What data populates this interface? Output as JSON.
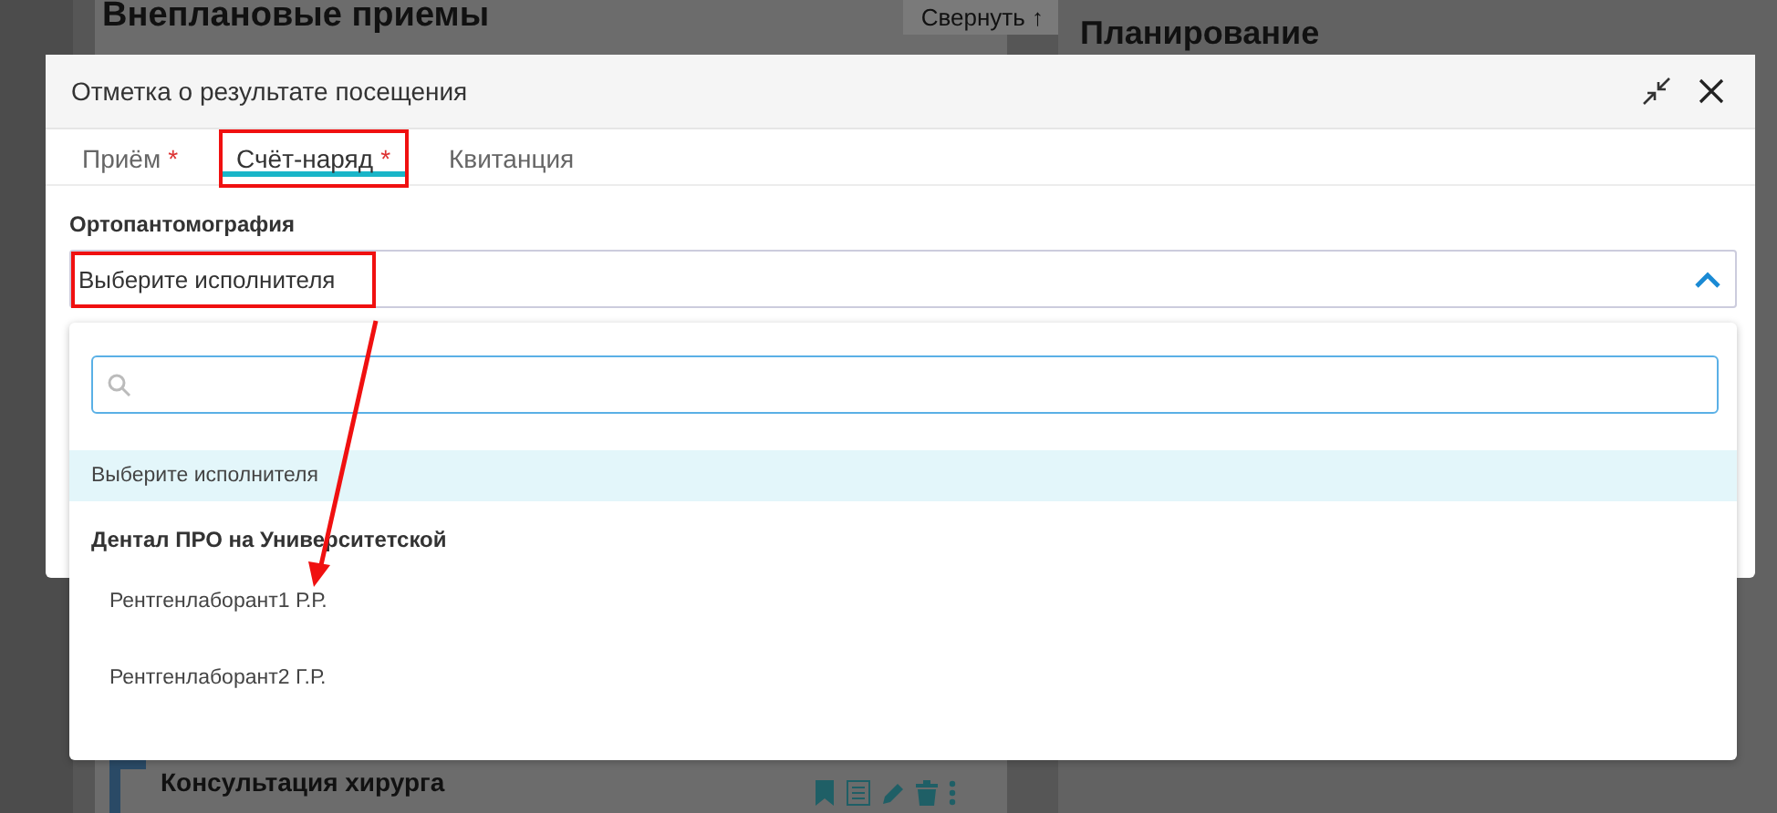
{
  "background": {
    "left_title": "Внеплановые приемы",
    "collapse_button": "Свернуть ↑",
    "right_title": "Планирование",
    "card_title": "Консультация хирурга"
  },
  "dialog": {
    "title": "Отметка о результате посещения",
    "tabs": [
      {
        "label": "Приём",
        "required_mark": "*",
        "selected": false,
        "annotated": false
      },
      {
        "label": "Счёт-наряд",
        "required_mark": "*",
        "selected": true,
        "annotated": true
      },
      {
        "label": "Квитанция",
        "selected": false,
        "annotated": false
      }
    ],
    "field": {
      "label": "Ортопантомография",
      "value": "Выберите исполнителя",
      "expanded": true,
      "annotated": true
    },
    "options": [
      {
        "kind": "option",
        "label": "Выберите исполнителя",
        "selected": true
      },
      {
        "kind": "group",
        "label": "Дентал ПРО на Университетской"
      },
      {
        "kind": "option",
        "label": "Рентгенлаборант1 Р.Р.",
        "selected": false
      },
      {
        "kind": "option",
        "label": "Рентгенлаборант2 Г.Р.",
        "selected": false
      }
    ],
    "annotation_arrow": true
  }
}
